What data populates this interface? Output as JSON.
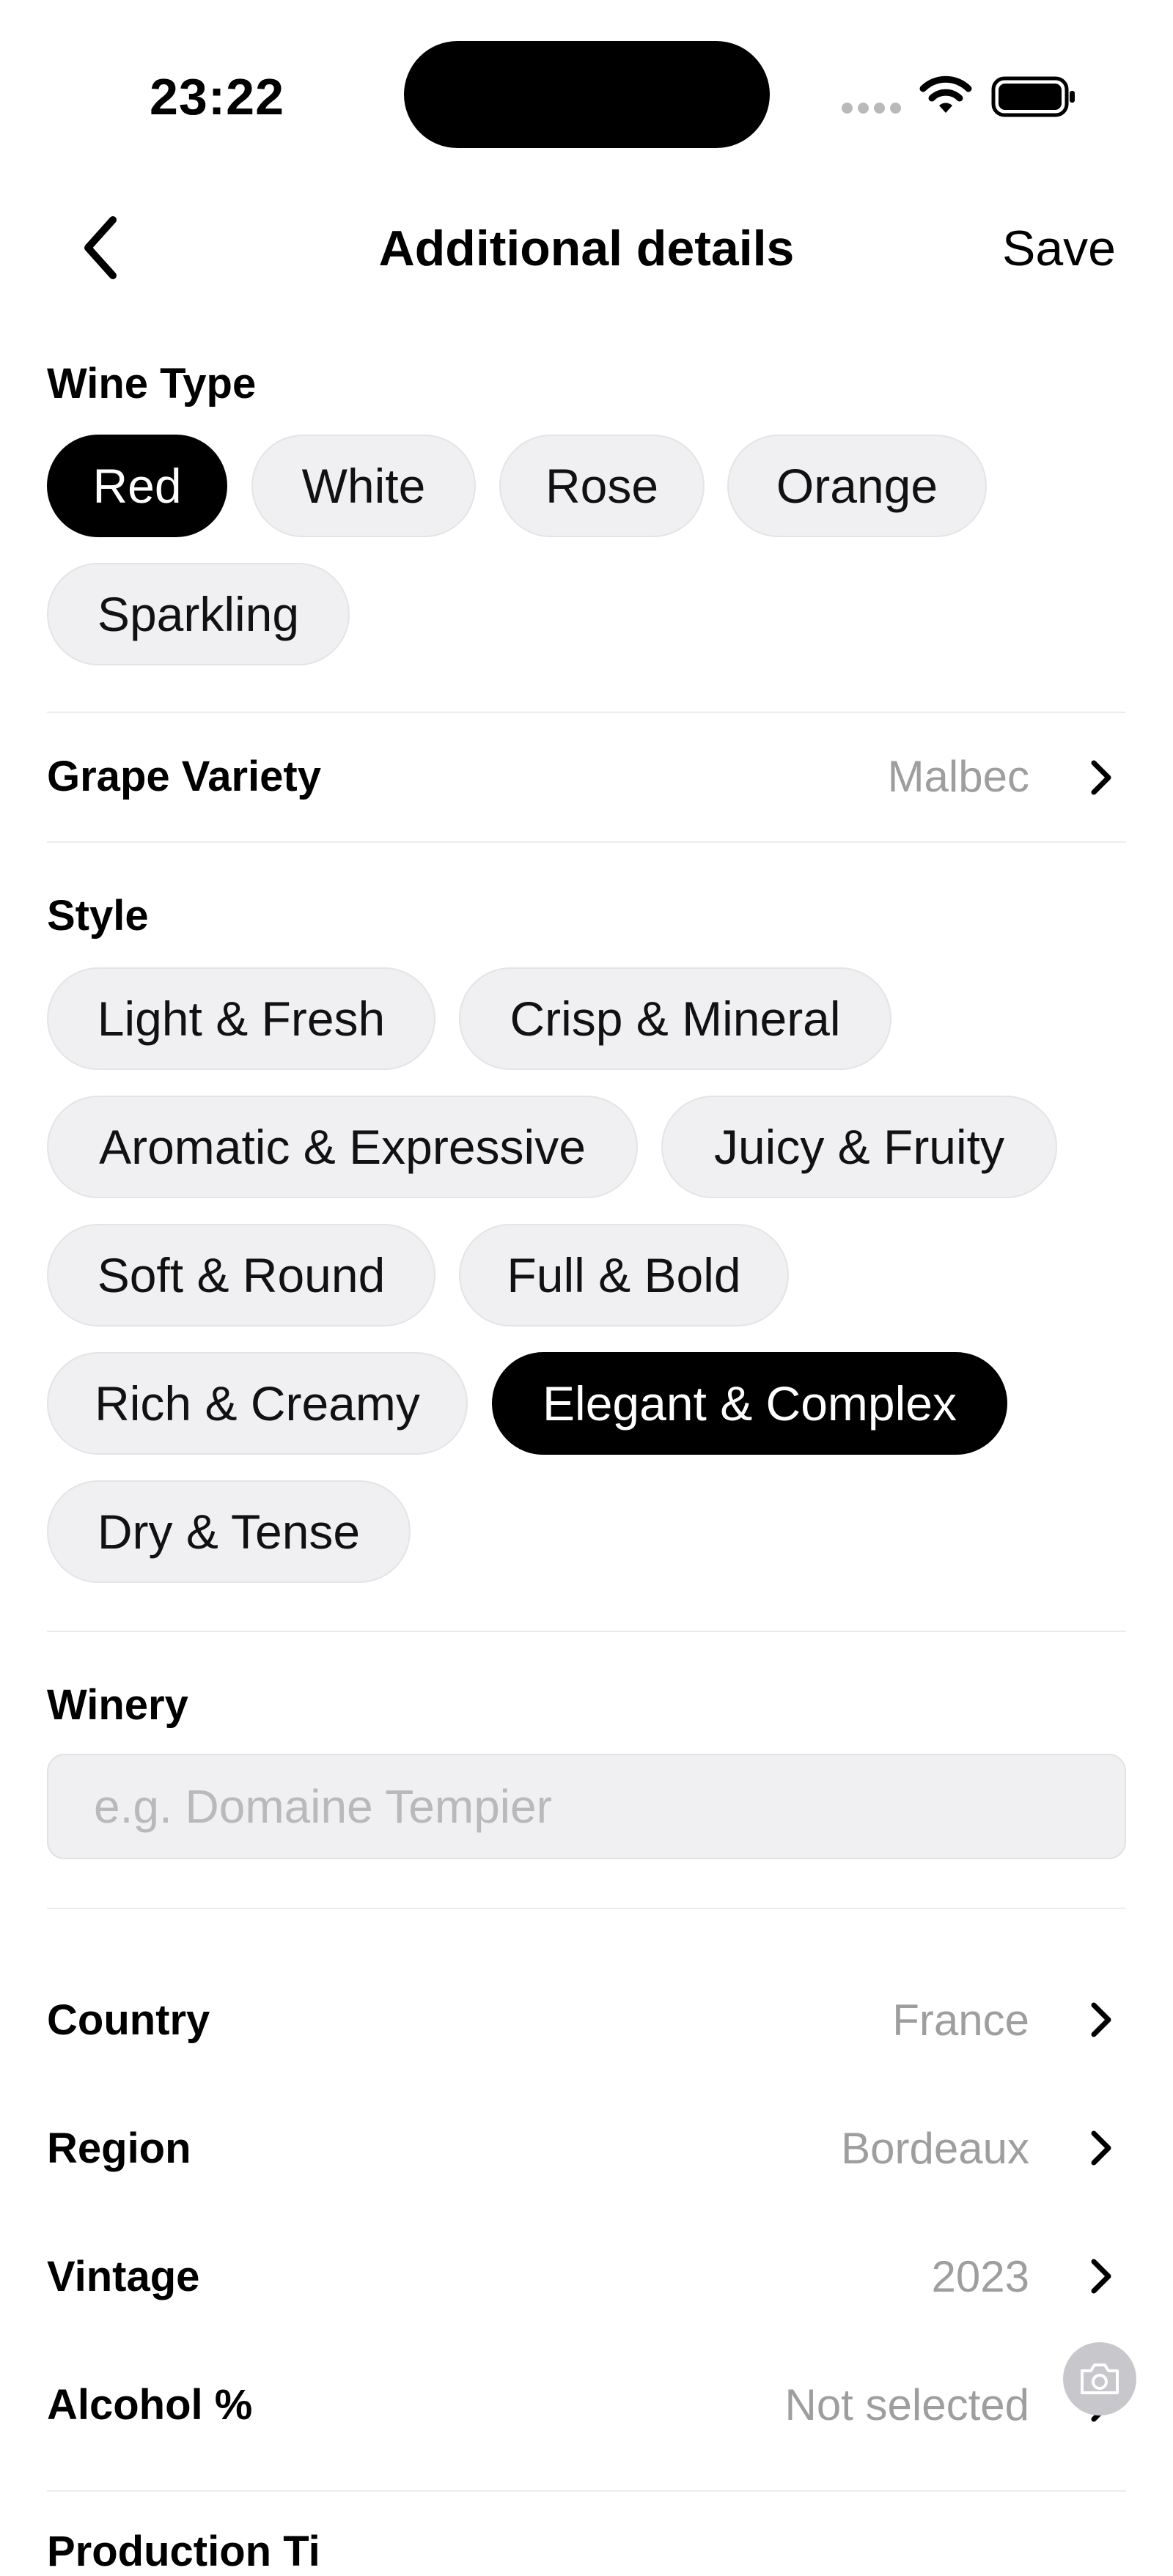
{
  "status_bar": {
    "time": "23:22"
  },
  "header": {
    "title": "Additional details",
    "save_label": "Save"
  },
  "wine_type": {
    "label": "Wine Type",
    "options": [
      "Red",
      "White",
      "Rose",
      "Orange",
      "Sparkling"
    ],
    "selected": "Red"
  },
  "grape_variety": {
    "label": "Grape Variety",
    "value": "Malbec"
  },
  "style": {
    "label": "Style",
    "options": [
      "Light & Fresh",
      "Crisp & Mineral",
      "Aromatic & Expressive",
      "Juicy & Fruity",
      "Soft & Round",
      "Full & Bold",
      "Rich & Creamy",
      "Elegant & Complex",
      "Dry & Tense"
    ],
    "selected": "Elegant & Complex"
  },
  "winery": {
    "label": "Winery",
    "value": "",
    "placeholder": "e.g. Domaine Tempier"
  },
  "details": [
    {
      "label": "Country",
      "value": "France"
    },
    {
      "label": "Region",
      "value": "Bordeaux"
    },
    {
      "label": "Vintage",
      "value": "2023"
    },
    {
      "label": "Alcohol %",
      "value": "Not selected"
    }
  ],
  "next_section": {
    "label": "Production Ti"
  },
  "icons": {
    "back": "chevron-left-icon",
    "row_chevron": "chevron-right-icon",
    "camera": "camera-icon",
    "wifi": "wifi-icon",
    "battery": "battery-icon"
  },
  "colors": {
    "selected_chip": "#000000",
    "chip_bg": "#f0f0f2",
    "muted_text": "#9e9e9e"
  }
}
